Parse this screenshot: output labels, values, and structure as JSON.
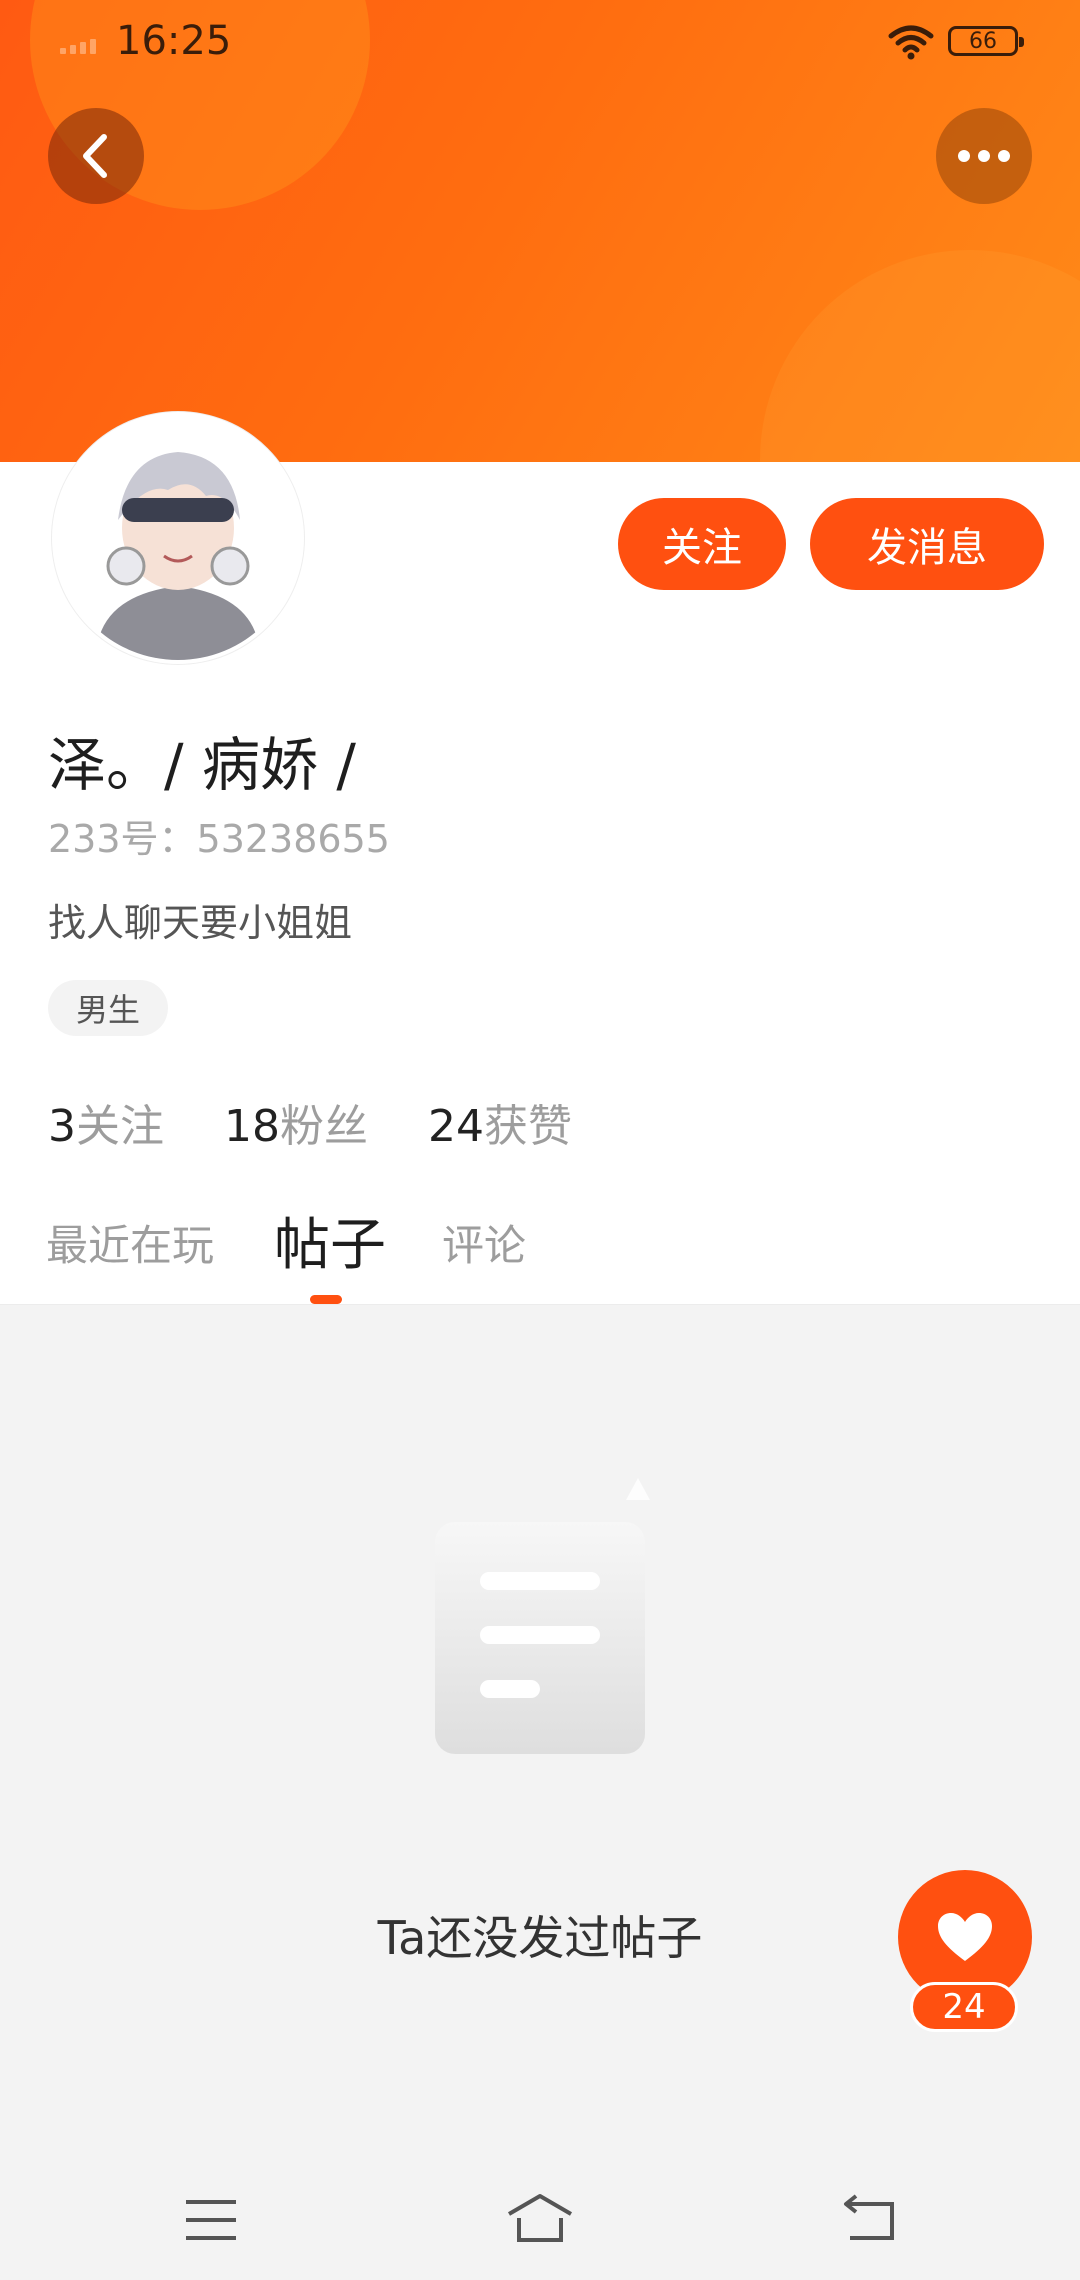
{
  "status_bar": {
    "time": "16:25",
    "battery": "66"
  },
  "profile": {
    "nickname": "泽。/ 病娇 /",
    "user_id": "233号：53238655",
    "bio": "找人聊天要小姐姐",
    "gender_tag": "男生",
    "buttons": {
      "follow": "关注",
      "message": "发消息"
    },
    "stats": [
      {
        "value": "3",
        "label": "关注"
      },
      {
        "value": "18",
        "label": "粉丝"
      },
      {
        "value": "24",
        "label": "获赞"
      }
    ]
  },
  "tabs": [
    {
      "label": "最近在玩",
      "active": false
    },
    {
      "label": "帖子",
      "active": true
    },
    {
      "label": "评论",
      "active": false
    }
  ],
  "empty_state": {
    "text": "Ta还没发过帖子"
  },
  "like": {
    "count": "24"
  },
  "colors": {
    "accent": "#ff5010",
    "hero_start": "#ff5a12",
    "hero_end": "#ff8a18"
  },
  "icons": [
    "back-arrow-icon",
    "more-dots-icon",
    "wifi-icon",
    "battery-icon",
    "heart-icon",
    "menu-icon",
    "home-icon",
    "return-icon",
    "document-icon"
  ]
}
